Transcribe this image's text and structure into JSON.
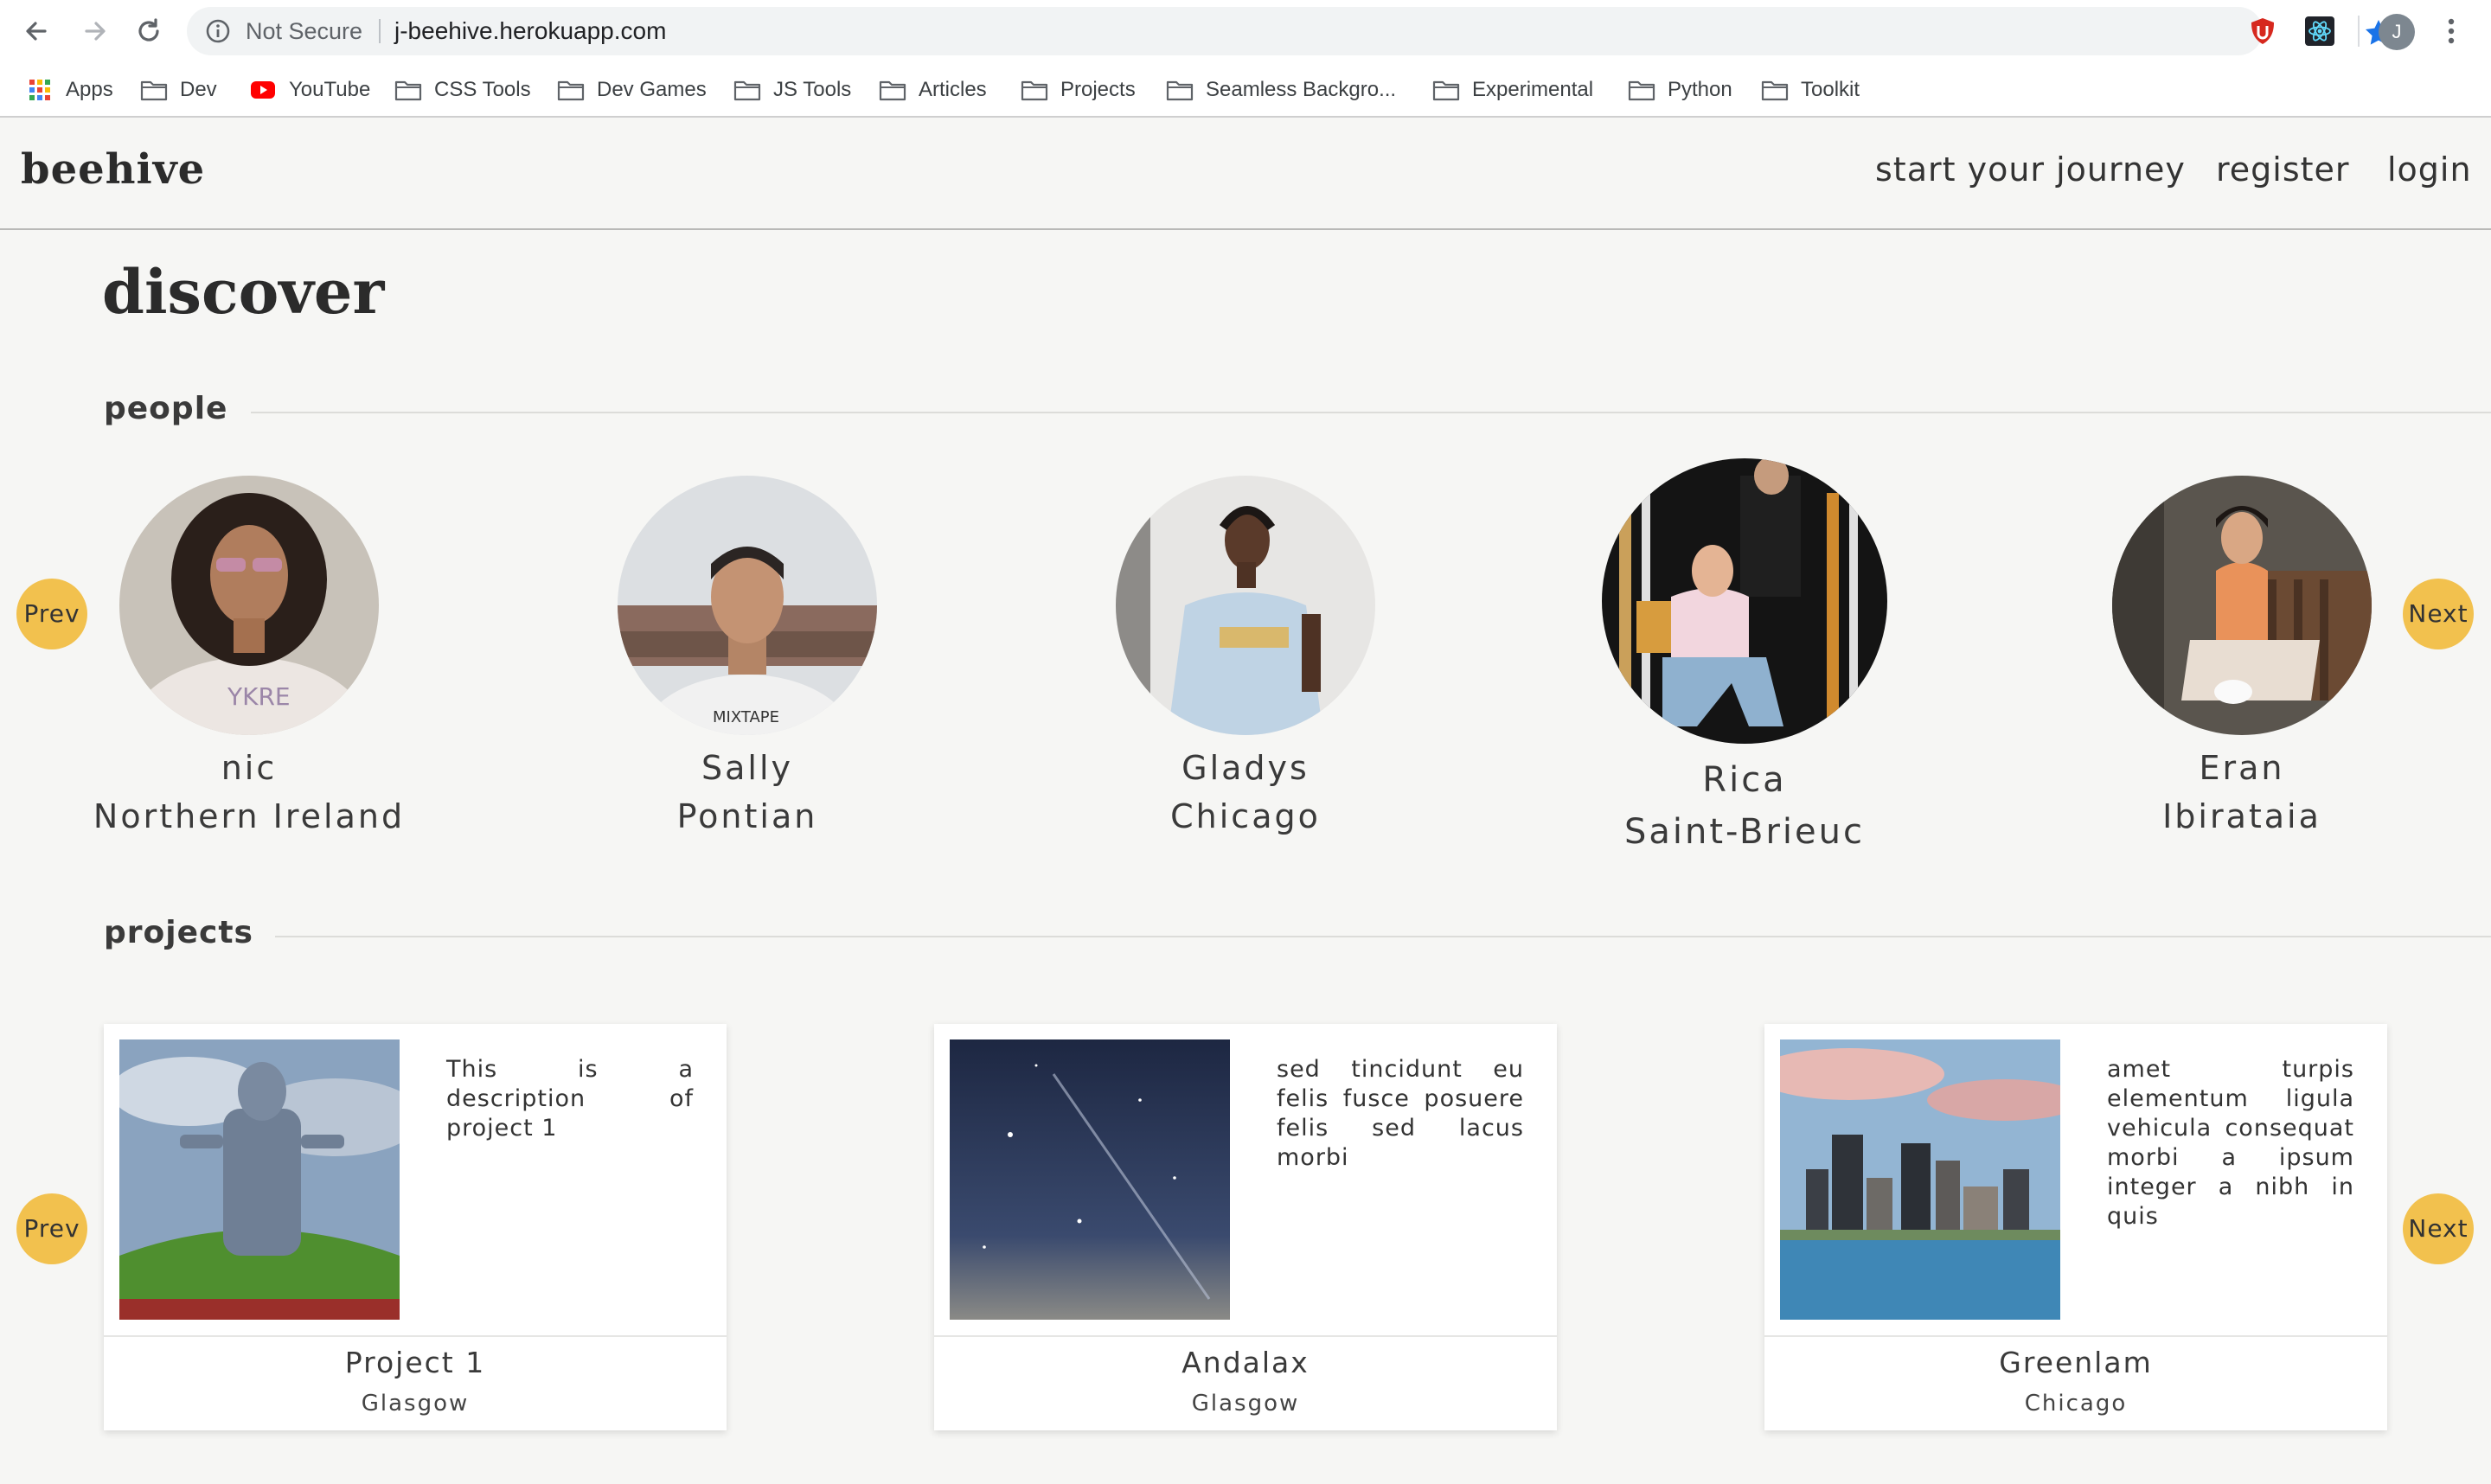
{
  "browser": {
    "security_label": "Not Secure",
    "url": "j-beehive.herokuapp.com",
    "profile_initial": "J",
    "bookmarks": [
      {
        "label": "Apps",
        "icon": "apps-grid-icon"
      },
      {
        "label": "Dev",
        "icon": "folder-icon"
      },
      {
        "label": "YouTube",
        "icon": "youtube-icon"
      },
      {
        "label": "CSS Tools",
        "icon": "folder-icon"
      },
      {
        "label": "Dev Games",
        "icon": "folder-icon"
      },
      {
        "label": "JS Tools",
        "icon": "folder-icon"
      },
      {
        "label": "Articles",
        "icon": "folder-icon"
      },
      {
        "label": "Projects",
        "icon": "folder-icon"
      },
      {
        "label": "Seamless Backgro...",
        "icon": "folder-icon"
      },
      {
        "label": "Experimental",
        "icon": "folder-icon"
      },
      {
        "label": "Python",
        "icon": "folder-icon"
      },
      {
        "label": "Toolkit",
        "icon": "folder-icon"
      }
    ]
  },
  "site": {
    "logo": "beehive",
    "nav": [
      "start your journey",
      "register",
      "login"
    ]
  },
  "page": {
    "title": "discover",
    "people_heading": "people",
    "projects_heading": "projects",
    "prev_label": "Prev",
    "next_label": "Next"
  },
  "people": [
    {
      "name": "nic",
      "location": "Northern Ireland"
    },
    {
      "name": "Sally",
      "location": "Pontian"
    },
    {
      "name": "Gladys",
      "location": "Chicago"
    },
    {
      "name": "Rica",
      "location": "Saint-Brieuc"
    },
    {
      "name": "Eran",
      "location": "Ibirataia"
    }
  ],
  "projects": [
    {
      "name": "Project 1",
      "location": "Glasgow",
      "description": "This is a description of project 1"
    },
    {
      "name": "Andalax",
      "location": "Glasgow",
      "description": "sed tincidunt eu felis fusce posuere felis sed lacus morbi"
    },
    {
      "name": "Greenlam",
      "location": "Chicago",
      "description": "amet turpis elementum ligula vehicula consequat morbi a ipsum integer a nibh in quis"
    }
  ],
  "colors": {
    "accent": "#f2c14e",
    "background": "#f6f6f4",
    "text": "#333333"
  }
}
